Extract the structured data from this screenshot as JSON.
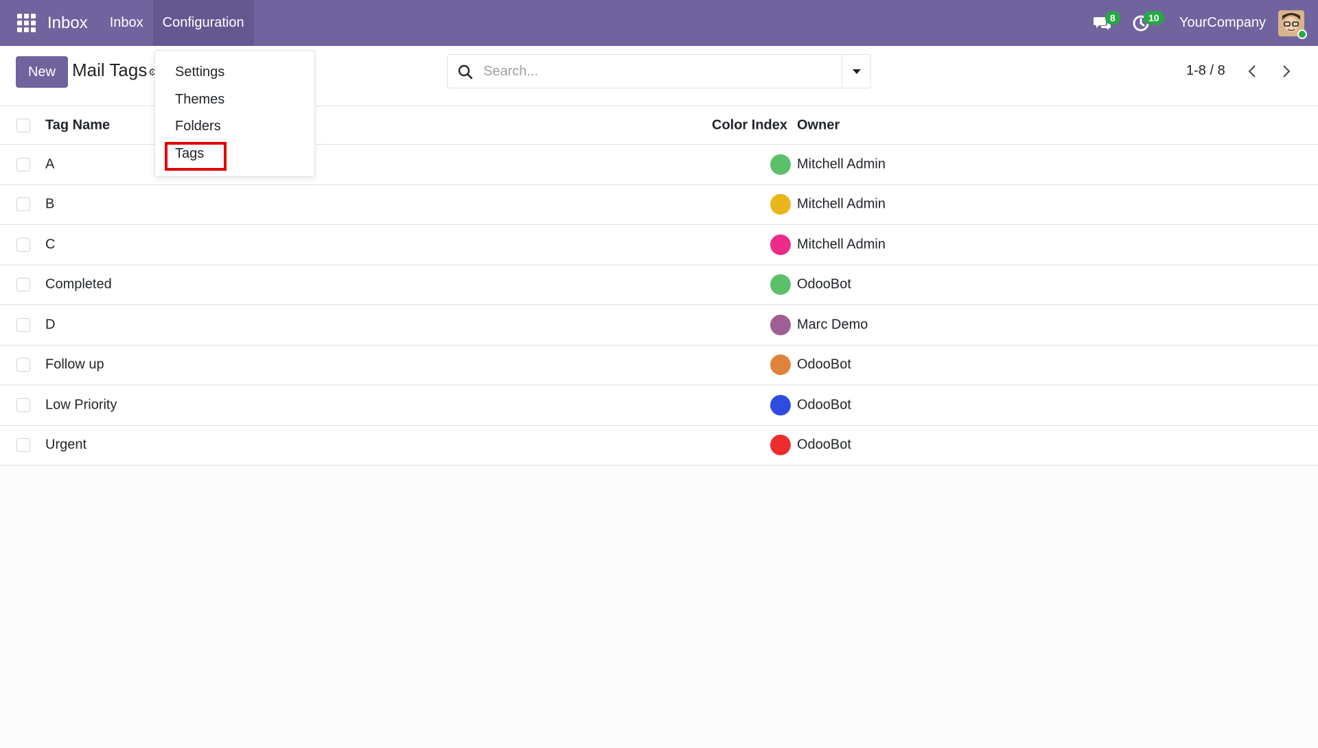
{
  "navbar": {
    "brand": "Inbox",
    "menu": [
      "Inbox",
      "Configuration"
    ],
    "messages_badge": "8",
    "activities_badge": "10",
    "company": "YourCompany",
    "bg_color": "#71639e"
  },
  "control": {
    "new_label": "New",
    "title": "Mail Tags",
    "search_placeholder": "Search...",
    "pager": "1-8 / 8"
  },
  "dropdown": {
    "items": [
      "Settings",
      "Themes",
      "Folders",
      "Tags"
    ],
    "highlighted": "Tags"
  },
  "table": {
    "headers": {
      "name": "Tag Name",
      "color": "Color Index",
      "owner": "Owner"
    },
    "rows": [
      {
        "name": "A",
        "color": "#5cc06a",
        "owner": "Mitchell Admin"
      },
      {
        "name": "B",
        "color": "#e8b61b",
        "owner": "Mitchell Admin"
      },
      {
        "name": "C",
        "color": "#ec2c89",
        "owner": "Mitchell Admin"
      },
      {
        "name": "Completed",
        "color": "#5cc06a",
        "owner": "OdooBot"
      },
      {
        "name": "D",
        "color": "#9e5f94",
        "owner": "Marc Demo"
      },
      {
        "name": "Follow up",
        "color": "#e0833a",
        "owner": "OdooBot"
      },
      {
        "name": "Low Priority",
        "color": "#2e4ce0",
        "owner": "OdooBot"
      },
      {
        "name": "Urgent",
        "color": "#ed2d2d",
        "owner": "OdooBot"
      }
    ]
  }
}
